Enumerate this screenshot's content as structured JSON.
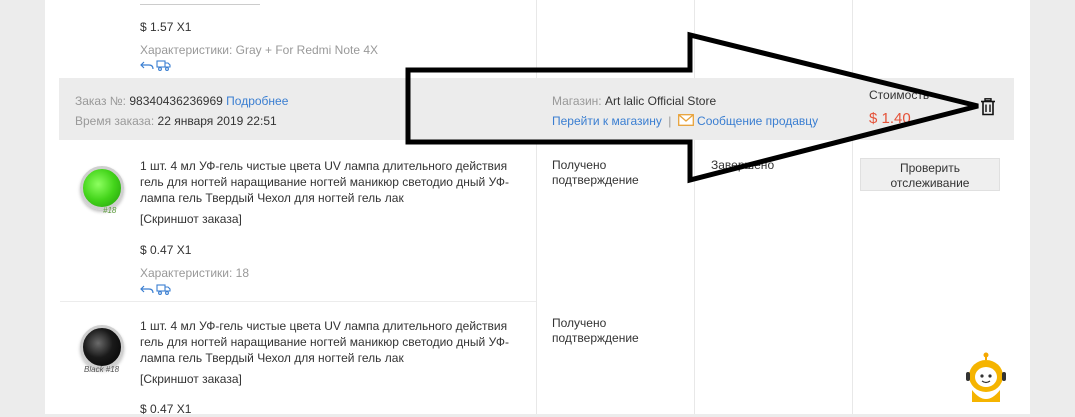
{
  "previous_item": {
    "price": "$ 1.57 X1",
    "characteristics": "Характеристики: Gray + For Redmi Note 4X"
  },
  "order": {
    "order_no_label": "Заказ №:",
    "order_no": "98340436236969",
    "details_link": "Подробнее",
    "time_label": "Время заказа:",
    "time_value": "22 января 2019 22:51",
    "store_label": "Магазин:",
    "store_name": "Art lalic Official Store",
    "goto_store": "Перейти к магазину",
    "message_seller": "Сообщение продавцу",
    "cost_label": "Стоимость",
    "cost_value": "$ 1.40"
  },
  "items": [
    {
      "title": "1 шт. 4 мл УФ-гель чистые цвета UV лампа длительного действия гель для ногтей наращивание ногтей маникюр светодио дный УФ-лампа гель Твердый Чехол для ногтей гель лак",
      "screenshot": "[Скриншот заказа]",
      "price": "$ 0.47 X1",
      "characteristics": "Характеристики: 18",
      "image_caption": "#18",
      "status": "Получено подтверждение",
      "status2": "Завершено",
      "track_button": "Проверить отслеживание"
    },
    {
      "title": "1 шт. 4 мл УФ-гель чистые цвета UV лампа длительного действия гель для ногтей наращивание ногтей маникюр светодио дный УФ-лампа гель Твердый Чехол для ногтей гель лак",
      "screenshot": "[Скриншот заказа]",
      "price": "$ 0.47 X1",
      "image_caption": "Black #18",
      "status": "Получено подтверждение"
    }
  ],
  "colors": {
    "link": "#3a7ed1",
    "price_red": "#e5533a",
    "header_bg": "#ececec",
    "green_product": "#43d41a"
  },
  "icons": [
    "return-icon",
    "truck-icon",
    "envelope-icon",
    "trash-icon",
    "assistant-robot-icon",
    "annotation-arrow"
  ]
}
